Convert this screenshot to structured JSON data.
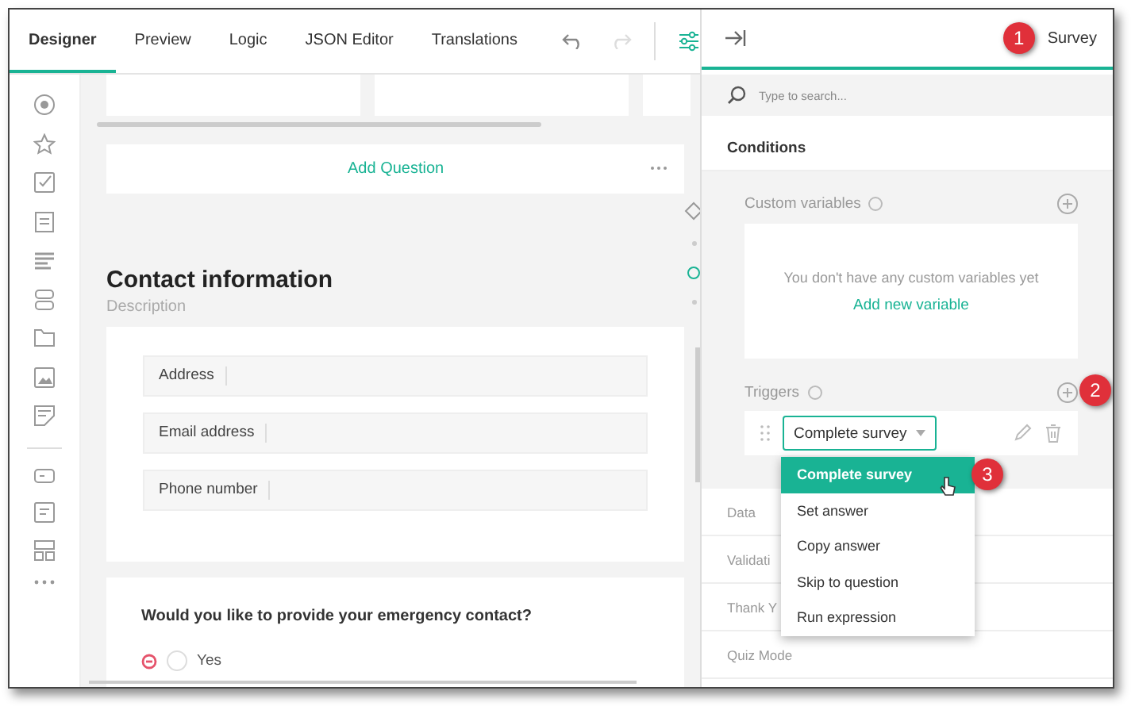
{
  "tabs": [
    {
      "label": "Designer",
      "selected": true
    },
    {
      "label": "Preview",
      "selected": false
    },
    {
      "label": "Logic",
      "selected": false
    },
    {
      "label": "JSON Editor",
      "selected": false
    },
    {
      "label": "Translations",
      "selected": false
    }
  ],
  "history_buttons": [
    {
      "kind": "undo",
      "disabled": false
    },
    {
      "kind": "redo",
      "disabled": true
    }
  ],
  "toolbox": [
    {
      "kind": "radio"
    },
    {
      "kind": "star"
    },
    {
      "kind": "checkbox"
    },
    {
      "kind": "list"
    },
    {
      "kind": "lines"
    },
    {
      "kind": "stack"
    },
    {
      "kind": "folder"
    },
    {
      "kind": "image"
    },
    {
      "kind": "sign"
    },
    {
      "kind": "separator"
    },
    {
      "kind": "input"
    },
    {
      "kind": "comment"
    },
    {
      "kind": "grid"
    },
    {
      "kind": "more"
    }
  ],
  "canvas": {
    "add_question": "Add Question",
    "page_title": "Contact information",
    "page_description": "Description",
    "fields": [
      "Address",
      "Email address",
      "Phone number"
    ],
    "question": {
      "title": "Would you like to provide your emergency contact?",
      "choices": [
        {
          "label": "Yes",
          "selected": false
        }
      ]
    }
  },
  "property_panel": {
    "title": "Survey",
    "search": {
      "placeholder": "Type to search..."
    },
    "category": "Conditions",
    "custom_variables": {
      "label": "Custom variables",
      "empty_text": "You don't have any custom variables yet",
      "link": "Add new variable"
    },
    "triggers": {
      "label": "Triggers",
      "items": [
        {
          "value": "Complete survey",
          "expanded": true
        }
      ]
    },
    "dropdown": [
      {
        "label": "Complete survey",
        "selected": true
      },
      {
        "label": "Set answer",
        "selected": false
      },
      {
        "label": "Copy answer",
        "selected": false
      },
      {
        "label": "Skip to question",
        "selected": false
      },
      {
        "label": "Run expression",
        "selected": false
      }
    ],
    "sections": [
      "Data",
      "Validati",
      "Thank Y",
      "Quiz Mode"
    ]
  },
  "callouts": [
    "1",
    "2",
    "3"
  ]
}
